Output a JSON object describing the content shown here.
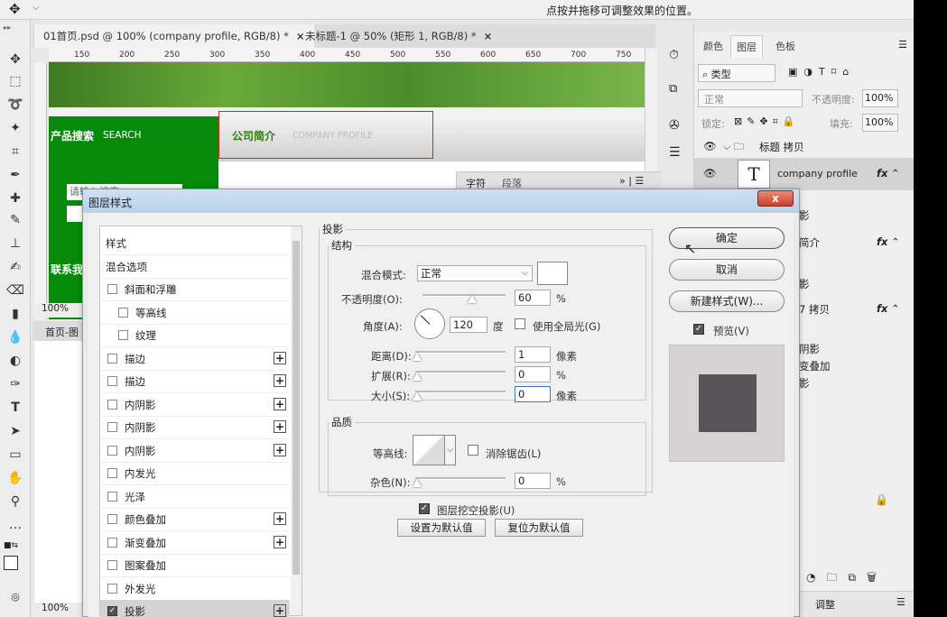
{
  "optbar": {
    "hint": "点按并拖移可调整效果的位置。"
  },
  "doc_tabs": [
    {
      "label": "01首页.psd @ 100% (company profile, RGB/8) *"
    },
    {
      "label": "未标题-1 @ 50% (矩形 1, RGB/8) *"
    }
  ],
  "ruler_ticks": [
    "150",
    "200",
    "250",
    "300",
    "350",
    "400",
    "450",
    "500",
    "550",
    "600",
    "650",
    "700",
    "750"
  ],
  "canvas": {
    "search_title": "产品搜索",
    "search_en": "SEARCH",
    "profile_title": "公司简介",
    "profile_en": "COMPANY PROFILE",
    "search_placeholder": "请输入搜索",
    "contact": "联系我",
    "zoom": "100%"
  },
  "second_doc": {
    "tab": "首页-图",
    "zoom": "100%"
  },
  "char_panel": {
    "tab1": "字符",
    "tab2": "段落"
  },
  "panel": {
    "tabs": [
      "颜色",
      "图层",
      "色板"
    ],
    "filter_kind": "类型",
    "blend": "正常",
    "opacity_label": "不透明度:",
    "opacity": "100%",
    "lock_label": "锁定:",
    "fill_label": "填充:",
    "fill": "100%",
    "layers": [
      {
        "name": "标题 拷贝",
        "type": "group"
      },
      {
        "name": "company profile",
        "type": "text",
        "fx": "fx"
      },
      {
        "name": "影",
        "type": "effect"
      },
      {
        "name": "简介",
        "type": "text",
        "fx": "fx"
      },
      {
        "name": "影",
        "type": "effect"
      },
      {
        "name": "7 拷贝",
        "type": "shape",
        "fx": "fx"
      },
      {
        "name": "阴影",
        "type": "effect"
      },
      {
        "name": "变叠加",
        "type": "effect"
      },
      {
        "name": "影",
        "type": "effect"
      }
    ],
    "adjust_tab": "调整"
  },
  "dialog": {
    "title": "图层样式",
    "close": "x",
    "styles": [
      {
        "label": "样式",
        "check": false,
        "plus": false,
        "indent": 0,
        "header": true
      },
      {
        "label": "混合选项",
        "check": false,
        "plus": false,
        "indent": 0,
        "header": true
      },
      {
        "label": "斜面和浮雕",
        "check": true,
        "plus": false,
        "indent": 0
      },
      {
        "label": "等高线",
        "check": true,
        "plus": false,
        "indent": 1
      },
      {
        "label": "纹理",
        "check": true,
        "plus": false,
        "indent": 1
      },
      {
        "label": "描边",
        "check": true,
        "plus": true,
        "indent": 0
      },
      {
        "label": "描边",
        "check": true,
        "plus": true,
        "indent": 0
      },
      {
        "label": "内阴影",
        "check": true,
        "plus": true,
        "indent": 0
      },
      {
        "label": "内阴影",
        "check": true,
        "plus": true,
        "indent": 0
      },
      {
        "label": "内阴影",
        "check": true,
        "plus": true,
        "indent": 0
      },
      {
        "label": "内发光",
        "check": true,
        "plus": false,
        "indent": 0
      },
      {
        "label": "光泽",
        "check": true,
        "plus": false,
        "indent": 0
      },
      {
        "label": "颜色叠加",
        "check": true,
        "plus": true,
        "indent": 0
      },
      {
        "label": "渐变叠加",
        "check": true,
        "plus": true,
        "indent": 0
      },
      {
        "label": "图案叠加",
        "check": true,
        "plus": false,
        "indent": 0
      },
      {
        "label": "外发光",
        "check": true,
        "plus": false,
        "indent": 0
      },
      {
        "label": "投影",
        "check": true,
        "checked": true,
        "plus": true,
        "indent": 0,
        "selected": true
      }
    ],
    "section": "投影",
    "structure": "结构",
    "blend_label": "混合模式:",
    "blend_value": "正常",
    "opacity_label": "不透明度(O):",
    "opacity_value": "60",
    "percent": "%",
    "angle_label": "角度(A):",
    "angle_value": "120",
    "degree": "度",
    "global_light": "使用全局光(G)",
    "distance_label": "距离(D):",
    "distance_value": "1",
    "pixel": "像素",
    "spread_label": "扩展(R):",
    "spread_value": "0",
    "size_label": "大小(S):",
    "size_value": "0",
    "quality": "品质",
    "contour_label": "等高线:",
    "antialias": "消除锯齿(L)",
    "noise_label": "杂色(N):",
    "noise_value": "0",
    "knockout": "图层挖空投影(U)",
    "make_default": "设置为默认值",
    "reset_default": "复位为默认值",
    "ok": "确定",
    "cancel": "取消",
    "new_style": "新建样式(W)...",
    "preview": "预览(V)"
  }
}
